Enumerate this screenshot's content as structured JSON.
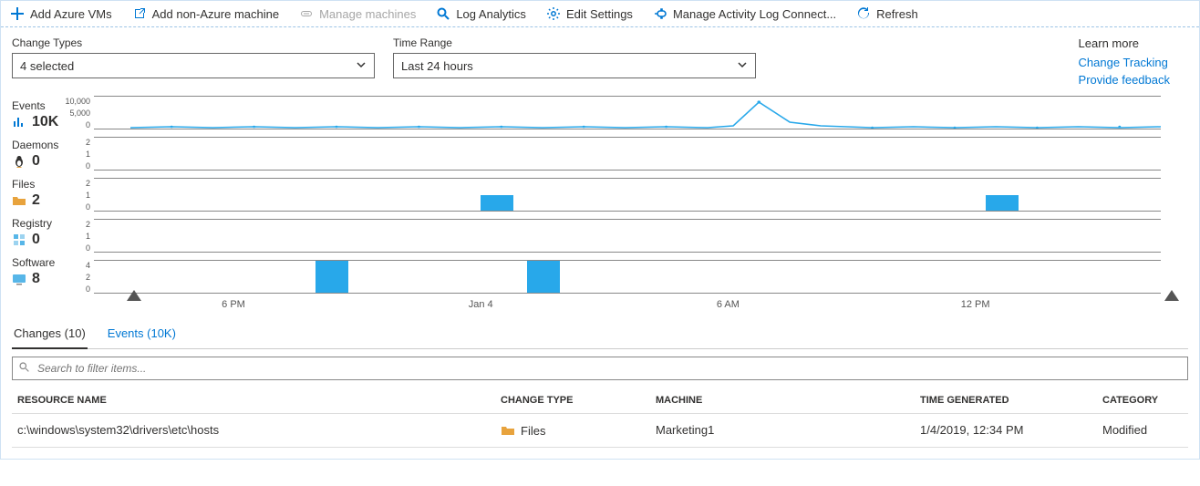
{
  "toolbar": {
    "add_azure_vms": "Add Azure VMs",
    "add_non_azure": "Add non-Azure machine",
    "manage_machines": "Manage machines",
    "log_analytics": "Log Analytics",
    "edit_settings": "Edit Settings",
    "manage_activity": "Manage Activity Log Connect...",
    "refresh": "Refresh"
  },
  "filters": {
    "change_types_label": "Change Types",
    "change_types_value": "4 selected",
    "time_range_label": "Time Range",
    "time_range_value": "Last 24 hours"
  },
  "learn_more": {
    "heading": "Learn more",
    "change_tracking": "Change Tracking",
    "provide_feedback": "Provide feedback"
  },
  "summary": {
    "events": {
      "label": "Events",
      "value": "10K"
    },
    "daemons": {
      "label": "Daemons",
      "value": "0"
    },
    "files": {
      "label": "Files",
      "value": "2"
    },
    "registry": {
      "label": "Registry",
      "value": "0"
    },
    "software": {
      "label": "Software",
      "value": "8"
    }
  },
  "chart_data": [
    {
      "type": "line",
      "name": "Events",
      "y_ticks": [
        "10,000",
        "5,000",
        "0"
      ],
      "ylim": [
        0,
        10000
      ],
      "x_ticks": [
        "6 PM",
        "Jan 4",
        "6 AM",
        "12 PM"
      ],
      "series": [
        {
          "name": "Events",
          "values_note": "spike ~9000 near 6 AM, small bumps elsewhere"
        }
      ]
    },
    {
      "type": "bar",
      "name": "Daemons",
      "y_ticks": [
        "2",
        "1",
        "0"
      ],
      "ylim": [
        0,
        2
      ],
      "bars": []
    },
    {
      "type": "bar",
      "name": "Files",
      "y_ticks": [
        "2",
        "1",
        "0"
      ],
      "ylim": [
        0,
        2
      ],
      "bars": [
        {
          "x_label": "~Jan 4 00:30",
          "value": 1
        },
        {
          "x_label": "~12:30 PM",
          "value": 1
        }
      ]
    },
    {
      "type": "bar",
      "name": "Registry",
      "y_ticks": [
        "2",
        "1",
        "0"
      ],
      "ylim": [
        0,
        2
      ],
      "bars": []
    },
    {
      "type": "bar",
      "name": "Software",
      "y_ticks": [
        "4",
        "2",
        "0"
      ],
      "ylim": [
        0,
        4
      ],
      "bars": [
        {
          "x_label": "~9 PM",
          "value": 4
        },
        {
          "x_label": "~Jan 4 01:00",
          "value": 4
        }
      ]
    }
  ],
  "axis": {
    "ticks": [
      "6 PM",
      "Jan 4",
      "6 AM",
      "12 PM"
    ]
  },
  "tabs": {
    "changes": "Changes (10)",
    "events": "Events (10K)"
  },
  "search": {
    "placeholder": "Search to filter items..."
  },
  "table": {
    "headers": {
      "name": "RESOURCE NAME",
      "type": "CHANGE TYPE",
      "machine": "MACHINE",
      "time": "TIME GENERATED",
      "category": "CATEGORY"
    },
    "rows": [
      {
        "name": "c:\\windows\\system32\\drivers\\etc\\hosts",
        "type": "Files",
        "machine": "Marketing1",
        "time": "1/4/2019, 12:34 PM",
        "category": "Modified"
      }
    ]
  }
}
